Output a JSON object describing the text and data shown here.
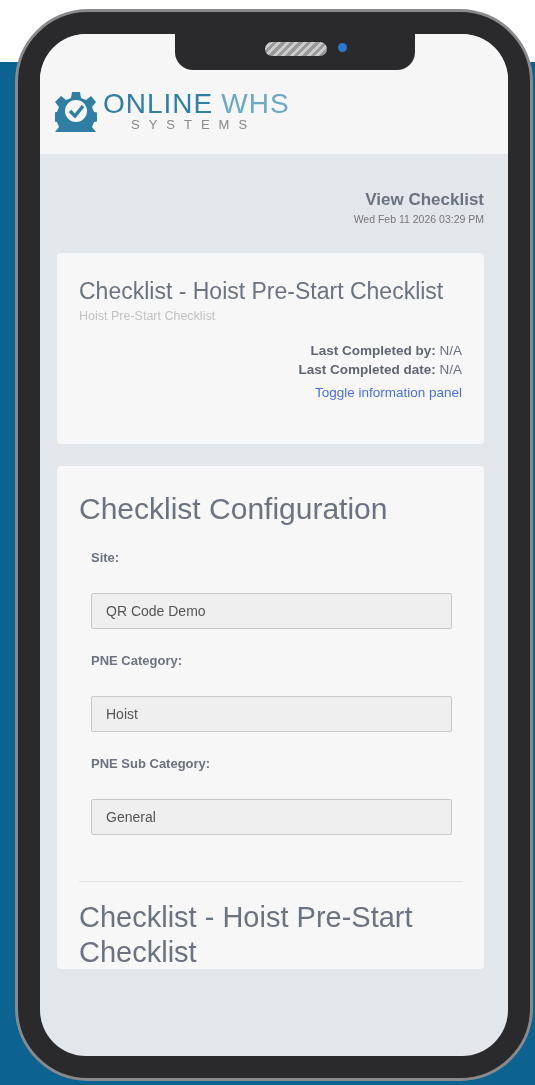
{
  "logo": {
    "name_first": "ONLINE",
    "name_second": "WHS",
    "tagline": "SYSTEMS"
  },
  "page_header": {
    "title": "View Checklist",
    "timestamp": "Wed Feb 11 2026 03:29 PM"
  },
  "info_card": {
    "title": "Checklist - Hoist Pre-Start Checklist",
    "subtitle": "Hoist Pre-Start Checklist",
    "details": [
      {
        "label": "Last Completed by:",
        "value": "N/A"
      },
      {
        "label": "Last Completed date:",
        "value": "N/A"
      }
    ],
    "link": "Toggle information panel"
  },
  "configuration": {
    "title": "Checklist Configuration",
    "fields": [
      {
        "label": "Site:",
        "value": "QR Code Demo"
      },
      {
        "label": "PNE Category:",
        "value": "Hoist"
      },
      {
        "label": "PNE Sub Category:",
        "value": "General"
      }
    ],
    "next_section_title": "Checklist - Hoist Pre-Start Checklist"
  }
}
